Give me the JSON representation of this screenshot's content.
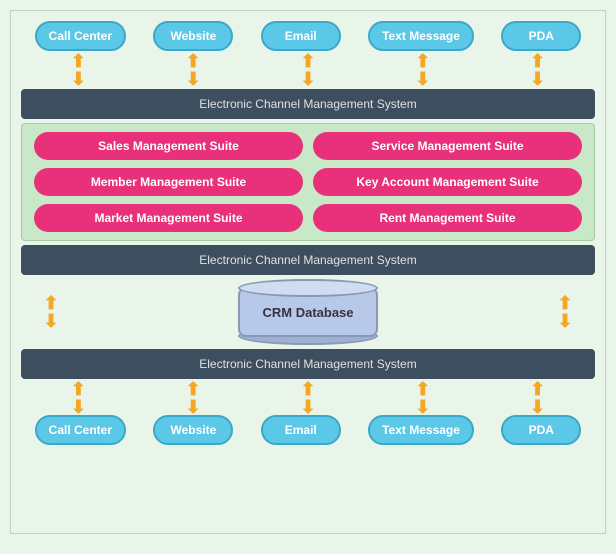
{
  "background_color": "#e8f5e8",
  "top_channels": [
    {
      "label": "Call Center",
      "id": "top-call-center"
    },
    {
      "label": "Website",
      "id": "top-website"
    },
    {
      "label": "Email",
      "id": "top-email"
    },
    {
      "label": "Text Message",
      "id": "top-text-message"
    },
    {
      "label": "PDA",
      "id": "top-pda"
    }
  ],
  "bottom_channels": [
    {
      "label": "Call Center",
      "id": "bot-call-center"
    },
    {
      "label": "Website",
      "id": "bot-website"
    },
    {
      "label": "Email",
      "id": "bot-email"
    },
    {
      "label": "Text Message",
      "id": "bot-text-message"
    },
    {
      "label": "PDA",
      "id": "bot-pda"
    }
  ],
  "ecms_label_top": "Electronic Channel Management System",
  "ecms_label_mid": "Electronic Channel Management System",
  "ecms_label_bot": "Electronic Channel Management System",
  "suite_left": [
    "Sales Management Suite",
    "Member Management Suite",
    "Market Management Suite"
  ],
  "suite_right": [
    "Service Management Suite",
    "Key Account Management Suite",
    "Rent Management Suite"
  ],
  "crm_label": "CRM Database",
  "arrow_symbol": "⇕"
}
